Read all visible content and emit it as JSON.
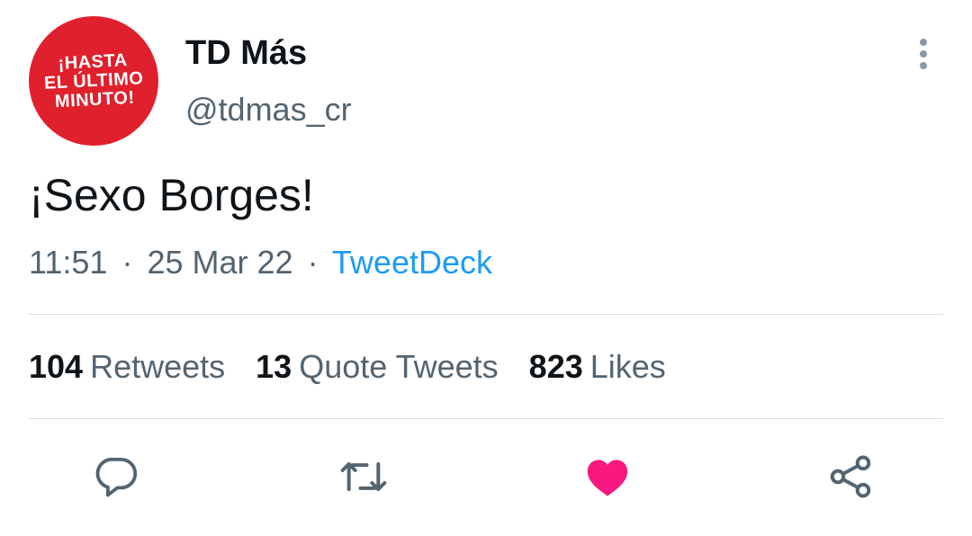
{
  "author": {
    "avatar_text": "¡HASTA\nEL ÚLTIMO\nMINUTO!",
    "display_name": "TD Más",
    "handle": "@tdmas_cr"
  },
  "tweet": {
    "text": "¡Sexo Borges!",
    "time": "11:51",
    "date": "25 Mar 22",
    "separator": "·",
    "source": "TweetDeck"
  },
  "stats": {
    "retweets": {
      "count": "104",
      "label": "Retweets"
    },
    "quotes": {
      "count": "13",
      "label": "Quote Tweets"
    },
    "likes": {
      "count": "823",
      "label": "Likes"
    }
  },
  "actions": {
    "reply_icon": "reply-icon",
    "retweet_icon": "retweet-icon",
    "like_icon": "heart-icon",
    "like_state": "liked",
    "share_icon": "share-icon"
  },
  "colors": {
    "avatar_bg": "#e0202d",
    "text_primary": "#0f1419",
    "text_secondary": "#536471",
    "link": "#1d9bf0",
    "like_active": "#f91880",
    "icon": "#536471"
  }
}
